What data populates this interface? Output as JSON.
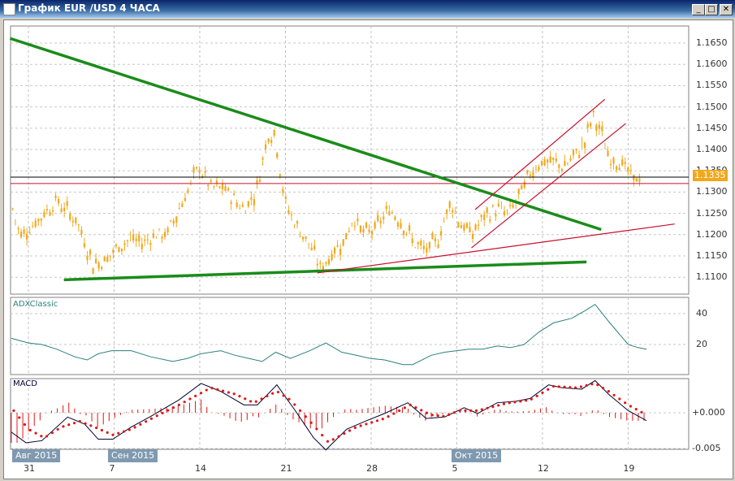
{
  "window": {
    "title": "График EUR /USD  4 ЧАСА",
    "minimize": "_",
    "maximize": "□",
    "close": "✕"
  },
  "price_axis": [
    "1.1650",
    "1.1600",
    "1.1550",
    "1.1500",
    "1.1450",
    "1.1400",
    "1.1350",
    "1.1300",
    "1.1250",
    "1.1200",
    "1.1150",
    "1.1100"
  ],
  "current_price": "1.1335",
  "adx": {
    "title": "ADXClassic",
    "ticks": [
      "40",
      "20"
    ]
  },
  "macd": {
    "title": "MACD",
    "ticks": [
      "+0.000",
      "-0.005"
    ]
  },
  "date_axis": [
    "31",
    "7",
    "14",
    "21",
    "28",
    "5",
    "12",
    "19"
  ],
  "months": [
    "Авг 2015",
    "Сен 2015",
    "Окт 2015"
  ],
  "colors": {
    "candle": "#f2a81d",
    "trend_green": "#1a8c1a",
    "trend_red": "#c8102e",
    "adx": "#2a7f7f",
    "macd_line": "#000033",
    "macd_signal": "#e01818",
    "grid": "#c0c0c0"
  },
  "chart_data": [
    {
      "type": "line",
      "name": "EUR/USD 4H price (approx close)",
      "x_unit": "days from Aug 31",
      "x": [
        -1.3,
        -0.7,
        0.3,
        1.3,
        2.3,
        3,
        4,
        4.6,
        5.3,
        6.3,
        7.3,
        8.3,
        9.3,
        10.3,
        11.3,
        12.3,
        13.3,
        13.9,
        14.9,
        15.9,
        16.9,
        17.6,
        18.6,
        19.6,
        20.2,
        20.9,
        21.9,
        22.9,
        23.9,
        24.9,
        25.9,
        26.5,
        27.5,
        28.5,
        29.5,
        30.5,
        31.5,
        32.5,
        33.5,
        34.5,
        35.2,
        36.2,
        37.2,
        38.2,
        39.2,
        40.1,
        41.1,
        41.8,
        42.8,
        43.8,
        44.8,
        45.5,
        46.1,
        46.8,
        47.4,
        48.4,
        49.4,
        50.1
      ],
      "close": [
        1.126,
        1.12,
        1.122,
        1.125,
        1.128,
        1.126,
        1.123,
        1.118,
        1.113,
        1.114,
        1.117,
        1.119,
        1.118,
        1.12,
        1.12,
        1.126,
        1.132,
        1.136,
        1.131,
        1.131,
        1.128,
        1.126,
        1.13,
        1.144,
        1.143,
        1.128,
        1.122,
        1.118,
        1.112,
        1.116,
        1.119,
        1.124,
        1.12,
        1.122,
        1.126,
        1.123,
        1.118,
        1.116,
        1.119,
        1.128,
        1.123,
        1.12,
        1.124,
        1.126,
        1.125,
        1.129,
        1.135,
        1.137,
        1.137,
        1.136,
        1.139,
        1.142,
        1.148,
        1.144,
        1.138,
        1.137,
        1.133,
        1.1335
      ],
      "ylim": [
        1.1075,
        1.168
      ],
      "trendlines": [
        {
          "color": "green",
          "from": [
            -1.5,
            1.1661
          ],
          "to": [
            46.8,
            1.1212
          ]
        },
        {
          "color": "green",
          "from": [
            2.9,
            1.1094
          ],
          "to": [
            45.6,
            1.1136
          ]
        },
        {
          "color": "red",
          "from": [
            23.6,
            1.111
          ],
          "to": [
            52.8,
            1.1225
          ]
        },
        {
          "color": "red",
          "from": [
            36.5,
            1.1259
          ],
          "to": [
            47.1,
            1.1518
          ]
        },
        {
          "color": "red",
          "from": [
            36.2,
            1.1169
          ],
          "to": [
            48.8,
            1.1461
          ]
        }
      ],
      "hlines": [
        {
          "color": "black",
          "y": 1.1335
        },
        {
          "color": "red",
          "y": 1.132
        }
      ]
    },
    {
      "type": "line",
      "name": "ADXClassic",
      "ylim": [
        0,
        50
      ],
      "x": [
        -1.4,
        0,
        1.1,
        2.3,
        3.8,
        4.8,
        5.7,
        6.8,
        8.4,
        10,
        11.8,
        13,
        14.1,
        15.7,
        16.9,
        18,
        19.1,
        20.2,
        21.4,
        23,
        24.3,
        25.6,
        26.8,
        27.9,
        29.1,
        30.6,
        31.4,
        32.9,
        34,
        35,
        36,
        37.1,
        38.3,
        39.4,
        40.5,
        41.7,
        42.9,
        44.4,
        45.5,
        46.3,
        47.4,
        49,
        49.8,
        50.5
      ],
      "y": [
        24,
        21,
        20,
        17,
        12,
        10,
        14,
        16,
        16,
        12,
        9,
        11,
        14,
        16,
        13,
        11,
        9,
        15,
        11,
        16,
        21,
        15,
        13,
        11,
        10,
        7,
        7,
        13,
        15,
        16,
        17,
        17,
        19,
        18,
        20,
        28,
        34,
        37,
        42,
        46,
        35,
        20,
        18,
        17
      ]
    },
    {
      "type": "line",
      "name": "MACD",
      "ylim": [
        -0.006,
        0.0055
      ],
      "macd": {
        "x": [
          -1.4,
          -0.2,
          1.1,
          3.2,
          4.6,
          5.7,
          6.9,
          8.4,
          10,
          12.3,
          14.1,
          15.7,
          17.6,
          18.7,
          20.3,
          21.8,
          23.3,
          24.3,
          26,
          27.5,
          29.1,
          31,
          32.5,
          34,
          35.6,
          36.7,
          38.3,
          39.8,
          41,
          42.5,
          43.6,
          45.2,
          46.3,
          47.4,
          49,
          50.5
        ],
        "y": [
          -0.0027,
          -0.0042,
          -0.0039,
          -0.0006,
          -0.0016,
          -0.0037,
          -0.0037,
          -0.002,
          -0.0005,
          0.0018,
          0.0041,
          0.003,
          0.0011,
          0.0011,
          0.0039,
          0.0003,
          -0.0035,
          -0.0052,
          -0.0023,
          -0.0012,
          -0.0001,
          0.0014,
          -0.0008,
          -0.0006,
          0.0007,
          -0.0001,
          0.0014,
          0.0016,
          0.002,
          0.0039,
          0.0035,
          0.0033,
          0.0045,
          0.0026,
          0.0003,
          -0.0011
        ]
      },
      "signal": {
        "x": [
          -1.2,
          0,
          1.3,
          2.7,
          4.2,
          5.4,
          6.9,
          8.4,
          10.3,
          12.3,
          14.9,
          16.9,
          18.4,
          20.3,
          21.4,
          23,
          24.5,
          26.8,
          29.1,
          31.2,
          32.9,
          34,
          35.2,
          36.7,
          39,
          41,
          42.9,
          44.8,
          46.3,
          47.4,
          49,
          50.5
        ],
        "y": [
          0.0003,
          -0.0023,
          -0.0035,
          -0.002,
          -0.0012,
          -0.002,
          -0.0031,
          -0.0023,
          -0.0006,
          0.0011,
          0.0035,
          0.0026,
          0.0014,
          0.003,
          0.0018,
          -0.0012,
          -0.0041,
          -0.002,
          -0.0008,
          0.0011,
          -0.0003,
          -0.0005,
          0.0003,
          0.0003,
          0.0013,
          0.0018,
          0.0037,
          0.0035,
          0.0041,
          0.003,
          0.0011,
          -0.0003
        ]
      }
    }
  ]
}
